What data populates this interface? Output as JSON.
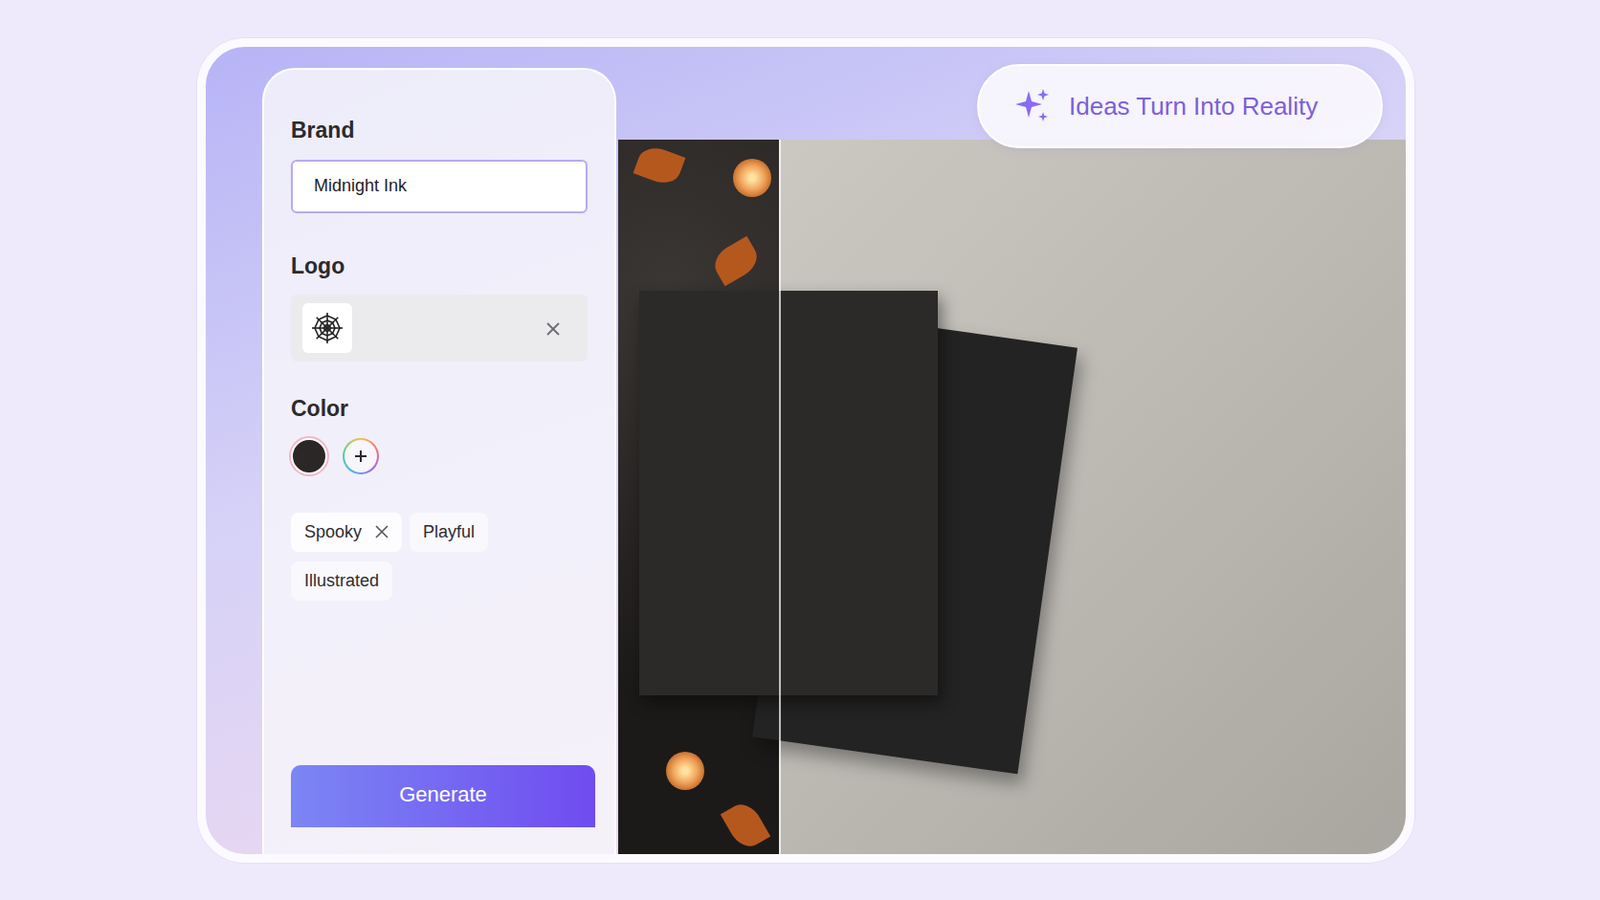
{
  "form": {
    "brand": {
      "label": "Brand",
      "value": "Midnight Ink"
    },
    "logo": {
      "label": "Logo"
    },
    "color": {
      "label": "Color",
      "swatches": [
        {
          "color": "#2b2727",
          "selected": true
        }
      ]
    },
    "tags": [
      {
        "label": "Spooky",
        "selected": true
      },
      {
        "label": "Playful",
        "selected": false
      },
      {
        "label": "Illustrated",
        "selected": false
      }
    ],
    "button": "Generate"
  },
  "badge": "Ideas Turn Into Reality"
}
